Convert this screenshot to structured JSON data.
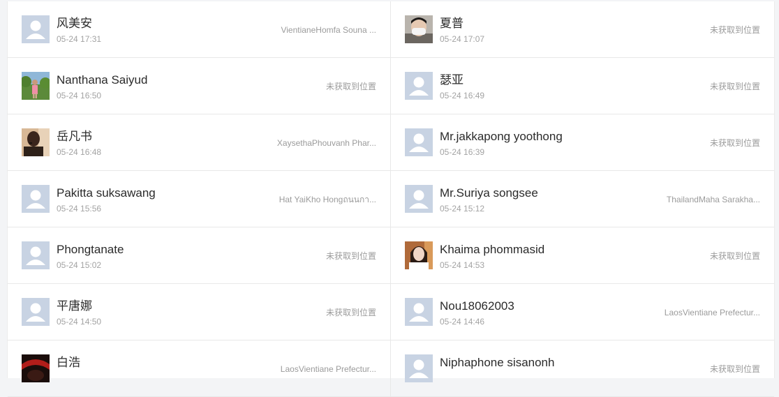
{
  "colors": {
    "page_background": "#f3f4f6",
    "card_background": "#ffffff",
    "divider": "#e8e8e8",
    "name_text": "#2b2b2b",
    "time_text": "#a3a3a3",
    "location_text": "#9b9b9b",
    "default_avatar_bg": "#c8d3e3",
    "default_avatar_fg": "#ffffff"
  },
  "users": [
    {
      "name": "风美安",
      "time": "05-24 17:31",
      "location": "VientianeHomfa Souna ...",
      "avatar": "default-avatar-icon"
    },
    {
      "name": "夏普",
      "time": "05-24 17:07",
      "location": "未获取到位置",
      "avatar": "photo-masked-person"
    },
    {
      "name": "Nanthana Saiyud",
      "time": "05-24 16:50",
      "location": "未获取到位置",
      "avatar": "photo-outdoor-person"
    },
    {
      "name": "瑟亚",
      "time": "05-24 16:49",
      "location": "未获取到位置",
      "avatar": "default-avatar-icon"
    },
    {
      "name": "岳凡书",
      "time": "05-24 16:48",
      "location": "XaysethaPhouvanh Phar...",
      "avatar": "photo-dark-person"
    },
    {
      "name": "Mr.jakkapong yoothong",
      "time": "05-24 16:39",
      "location": "未获取到位置",
      "avatar": "default-avatar-icon"
    },
    {
      "name": "Pakitta suksawang",
      "time": "05-24 15:56",
      "location": "Hat YaiKho Hongถนนกา...",
      "avatar": "default-avatar-icon"
    },
    {
      "name": "Mr.Suriya songsee",
      "time": "05-24 15:12",
      "location": "ThailandMaha Sarakha...",
      "avatar": "default-avatar-icon"
    },
    {
      "name": "Phongtanate",
      "time": "05-24 15:02",
      "location": "未获取到位置",
      "avatar": "default-avatar-icon"
    },
    {
      "name": "Khaima phommasid",
      "time": "05-24 14:53",
      "location": "未获取到位置",
      "avatar": "photo-woman"
    },
    {
      "name": "平唐娜",
      "time": "05-24 14:50",
      "location": "未获取到位置",
      "avatar": "default-avatar-icon"
    },
    {
      "name": "Nou18062003",
      "time": "05-24 14:46",
      "location": "LaosVientiane Prefectur...",
      "avatar": "default-avatar-icon"
    },
    {
      "name": "白浩",
      "time": "",
      "location": "LaosVientiane Prefectur...",
      "avatar": "photo-red-dark"
    },
    {
      "name": "Niphaphone sisanonh",
      "time": "",
      "location": "未获取到位置",
      "avatar": "default-avatar-icon"
    }
  ]
}
